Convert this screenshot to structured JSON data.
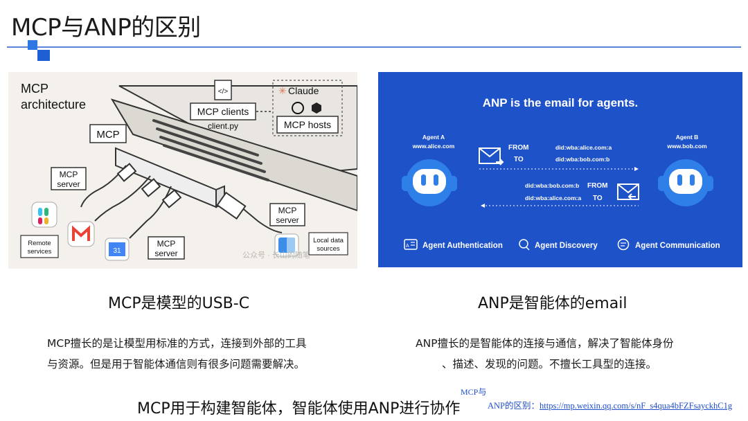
{
  "slide": {
    "title": "MCP与ANP的区别"
  },
  "mcp_panel": {
    "heading_line1": "MCP",
    "heading_line2": "architecture",
    "clients_label": "MCP clients",
    "clients_file": "client.py",
    "mcp_label": "MCP",
    "claude_label": "Claude",
    "hosts_label": "MCP hosts",
    "server_left_line1": "MCP",
    "server_left_line2": "server",
    "server_right_line1": "MCP",
    "server_right_line2": "server",
    "server_bottom_line1": "MCP",
    "server_bottom_line2": "server",
    "remote_line1": "Remote",
    "remote_line2": "services",
    "local_line1": "Local data",
    "local_line2": "sources",
    "calendar_number": "31",
    "watermark": "公众号 · 长山的随笔"
  },
  "anp_panel": {
    "title": "ANP is the email for agents.",
    "agent_a_name": "Agent A",
    "agent_a_site": "www.alice.com",
    "agent_b_name": "Agent B",
    "agent_b_site": "www.bob.com",
    "from_label": "FROM",
    "to_label": "TO",
    "msg1_from": "did:wba:alice.com:a",
    "msg1_to": "did:wba:bob.com:b",
    "msg2_from": "did:wba:bob.com:b",
    "msg2_to": "did:wba:alice.com:a",
    "feature_1": "Agent Authentication",
    "feature_2": "Agent Discovery",
    "feature_3": "Agent Communication"
  },
  "captions": {
    "left": "MCP是模型的USB-C",
    "right": "ANP是智能体的email"
  },
  "descriptions": {
    "left_line1": "MCP擅长的是让模型用标准的方式，连接到外部的工具",
    "left_line2": "与资源。但是用于智能体通信则有很多问题需要解决。",
    "right_line1": "ANP擅长的是智能体的连接与通信，解决了智能体身份",
    "right_line2": "、描述、发现的问题。不擅长工具型的连接。"
  },
  "bottom_text": "MCP用于构建智能体，智能体使用ANP进行协作",
  "source_note": {
    "line1": "MCP与",
    "line2_prefix": "ANP的区别：",
    "line2_link": "https://mp.weixin.qq.com/s/nF_s4qua4bFZFsayckhC1g"
  },
  "colors": {
    "accent_blue": "#1e52c9",
    "rule_blue": "#5b84d6",
    "left_panel_bg": "#f4f1ec",
    "claude_orange": "#d97757",
    "gmail_red": "#ea4335"
  }
}
